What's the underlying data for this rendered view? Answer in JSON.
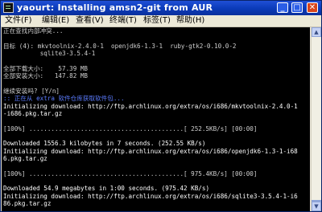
{
  "window": {
    "title": "yaourt: Installing amsn2-git from AUR"
  },
  "window_controls": {
    "minimize": "_",
    "maximize": "□",
    "close": "✕"
  },
  "menu": [
    "文件(F)",
    "编辑(E)",
    "查看(V)",
    "终端(T)",
    "标签(T)",
    "帮助(H)"
  ],
  "terminal_lines": [
    {
      "text": "正在查找内部冲突...",
      "color": "gray"
    },
    {
      "text": "",
      "color": "gray"
    },
    {
      "text": "目标 (4): mkvtoolnix-2.4.0-1  openjdk6-1.3-1  ruby-gtk2-0.10.0-2",
      "color": "gray"
    },
    {
      "text": "          sqlite3-3.5.4-1",
      "color": "gray"
    },
    {
      "text": "",
      "color": "gray"
    },
    {
      "text": "全部下载大小:    57.39 MB",
      "color": "gray"
    },
    {
      "text": "全部安装大小:   147.82 MB",
      "color": "gray"
    },
    {
      "text": "",
      "color": "gray"
    },
    {
      "text": "继续安装吗? [Y/n]",
      "color": "gray"
    },
    {
      "text": ":: 正在从 extra 软件仓库获取软件包...",
      "color": "blue"
    },
    {
      "text": "Initializing download: http://ftp.archlinux.org/extra/os/i686/mkvtoolnix-2.4.0-1",
      "color": "white"
    },
    {
      "text": "-i686.pkg.tar.gz",
      "color": "white"
    },
    {
      "text": "",
      "color": "gray"
    },
    {
      "text": "[100%] ..........................................[ 252.5KB/s] [00:00]",
      "color": "gray"
    },
    {
      "text": "",
      "color": "gray"
    },
    {
      "text": "Downloaded 1556.3 kilobytes in 7 seconds. (252.55 KB/s)",
      "color": "white"
    },
    {
      "text": "Initializing download: http://ftp.archlinux.org/extra/os/i686/openjdk6-1.3-1-i68",
      "color": "white"
    },
    {
      "text": "6.pkg.tar.gz",
      "color": "white"
    },
    {
      "text": "",
      "color": "gray"
    },
    {
      "text": "[100%] ..........................................[ 975.4KB/s] [00:00]",
      "color": "gray"
    },
    {
      "text": "",
      "color": "gray"
    },
    {
      "text": "Downloaded 54.9 megabytes in 1:00 seconds. (975.42 KB/s)",
      "color": "white"
    },
    {
      "text": "Initializing download: http://ftp.archlinux.org/extra/os/i686/sqlite3-3.5.4-1-i6",
      "color": "white"
    },
    {
      "text": "86.pkg.tar.gz",
      "color": "white"
    }
  ]
}
